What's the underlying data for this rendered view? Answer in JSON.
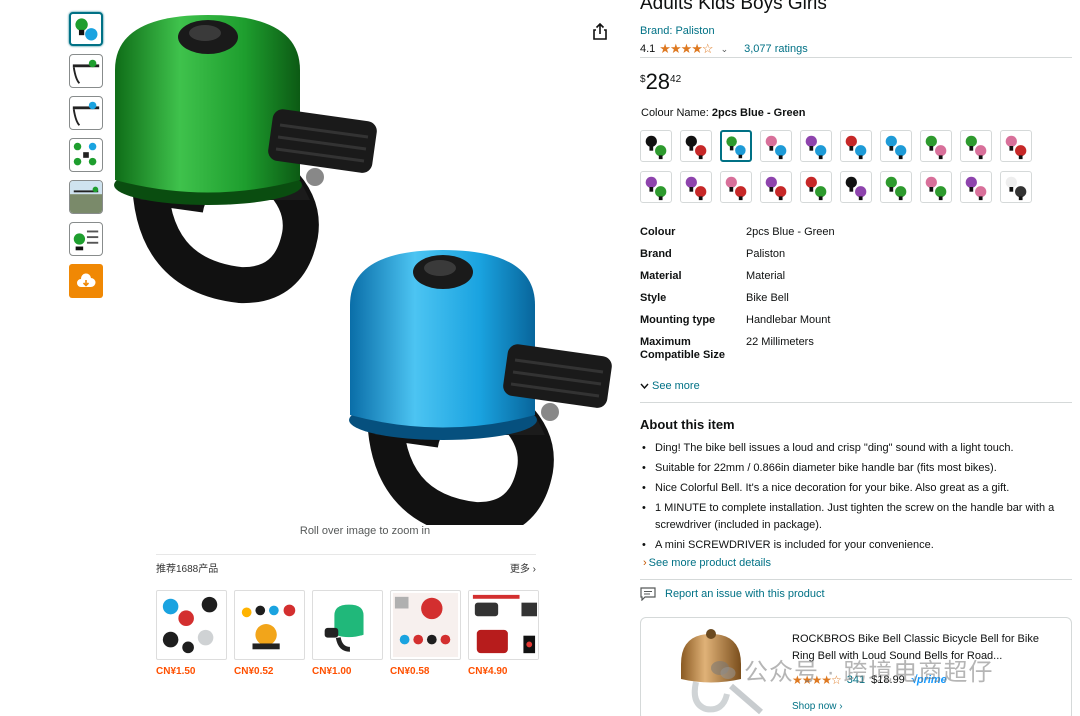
{
  "product": {
    "title": "Adults Kids Boys Girls",
    "brand_link": "Brand: Paliston",
    "rating": "4.1",
    "stars": "★★★★☆",
    "ratings_count": "3,077 ratings",
    "price_symbol": "$",
    "price_whole": "28",
    "price_fraction": "42",
    "colour_label": "Colour Name:",
    "colour_selected": "2pcs Blue - Green"
  },
  "gallery": {
    "zoom_hint": "Roll over image to zoom in"
  },
  "swatch_colors": [
    [
      "#111111",
      "#2e9a2e"
    ],
    [
      "#111111",
      "#c62828"
    ],
    [
      "#2e9a2e",
      "#1e9bd7"
    ],
    [
      "#d8709a",
      "#1e9bd7"
    ],
    [
      "#8e44ad",
      "#1e9bd7"
    ],
    [
      "#c62828",
      "#1e9bd7"
    ],
    [
      "#1e9bd7",
      "#1e9bd7"
    ],
    [
      "#2e9a2e",
      "#d8709a"
    ],
    [
      "#2e9a2e",
      "#d8709a"
    ],
    [
      "#d8709a",
      "#c62828"
    ],
    [
      "#8e44ad",
      "#2e9a2e"
    ],
    [
      "#8e44ad",
      "#c62828"
    ],
    [
      "#d8709a",
      "#c62828"
    ],
    [
      "#8e44ad",
      "#c62828"
    ],
    [
      "#c62828",
      "#2e9a2e"
    ],
    [
      "#111111",
      "#8e44ad"
    ],
    [
      "#2e9a2e",
      "#2e9a2e"
    ],
    [
      "#d8709a",
      "#2e9a2e"
    ],
    [
      "#8e44ad",
      "#d8709a"
    ],
    [
      "#eeeeee",
      "#333333"
    ]
  ],
  "specs": [
    {
      "key": "Colour",
      "value": "2pcs Blue - Green"
    },
    {
      "key": "Brand",
      "value": "Paliston"
    },
    {
      "key": "Material",
      "value": "Material"
    },
    {
      "key": "Style",
      "value": "Bike Bell"
    },
    {
      "key": "Mounting type",
      "value": "Handlebar Mount"
    },
    {
      "key": "Maximum Compatible Size",
      "value": "22 Millimeters"
    }
  ],
  "see_more": "See more",
  "about": {
    "title": "About this item",
    "bullets": [
      "Ding! The bike bell issues a loud and crisp \"ding\" sound with a light touch.",
      "Suitable for 22mm / 0.866in diameter bike handle bar (fits most bikes).",
      "Nice Colorful Bell. It's a nice decoration for your bike. Also great as a gift.",
      "1 MINUTE to complete installation. Just tighten the screw on the handle bar with a screwdriver (included in package).",
      "A mini SCREWDRIVER is included for your convenience."
    ],
    "details_link": "See more product details"
  },
  "report_link": "Report an issue with this product",
  "recommend": {
    "header": "推荐1688产品",
    "more": "更多 ›",
    "prices": [
      "CN¥1.50",
      "CN¥0.52",
      "CN¥1.00",
      "CN¥0.58",
      "CN¥4.90"
    ]
  },
  "ad": {
    "title": "ROCKBROS Bike Bell Classic Bicycle Bell for Bike Ring Bell with Loud Sound Bells for Road...",
    "stars": "★★★★☆",
    "count": "341",
    "price": "$18.99",
    "prime": "√prime",
    "shop": "Shop now ›"
  },
  "watermark": "公众号 · 跨境电商超仔",
  "colors": {
    "link": "#007185",
    "star": "#de7921",
    "cn_price": "#ff5000",
    "upload_btn": "#f08804",
    "bell_green": "#1e9e2e",
    "bell_blue": "#1aa3e0"
  }
}
